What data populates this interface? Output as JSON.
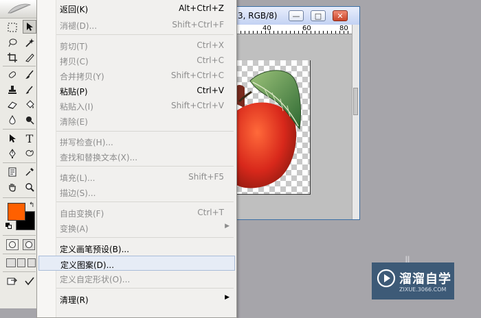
{
  "document": {
    "title": "3, RGB/8)",
    "ruler_labels": [
      "40",
      "60",
      "80"
    ],
    "buttons": {
      "minimize": "—",
      "maximize": "□",
      "close": "✕"
    }
  },
  "menu": {
    "items": [
      {
        "label": "返回(K)",
        "shortcut": "Alt+Ctrl+Z",
        "enabled": true
      },
      {
        "label": "消褪(D)...",
        "shortcut": "Shift+Ctrl+F",
        "enabled": false
      },
      {
        "label": "剪切(T)",
        "shortcut": "Ctrl+X",
        "enabled": false
      },
      {
        "label": "拷贝(C)",
        "shortcut": "Ctrl+C",
        "enabled": false
      },
      {
        "label": "合并拷贝(Y)",
        "shortcut": "Shift+Ctrl+C",
        "enabled": false
      },
      {
        "label": "粘贴(P)",
        "shortcut": "Ctrl+V",
        "enabled": true
      },
      {
        "label": "粘贴入(I)",
        "shortcut": "Shift+Ctrl+V",
        "enabled": false
      },
      {
        "label": "清除(E)",
        "shortcut": "",
        "enabled": false
      },
      {
        "label": "拼写检查(H)...",
        "shortcut": "",
        "enabled": false
      },
      {
        "label": "查找和替换文本(X)...",
        "shortcut": "",
        "enabled": false
      },
      {
        "label": "填充(L)...",
        "shortcut": "Shift+F5",
        "enabled": false
      },
      {
        "label": "描边(S)...",
        "shortcut": "",
        "enabled": false
      },
      {
        "label": "自由变换(F)",
        "shortcut": "Ctrl+T",
        "enabled": false
      },
      {
        "label": "变换(A)",
        "shortcut": "",
        "enabled": false,
        "submenu": true
      },
      {
        "label": "定义画笔预设(B)...",
        "shortcut": "",
        "enabled": true
      },
      {
        "label": "定义图案(D)...",
        "shortcut": "",
        "enabled": true,
        "highlighted": true
      },
      {
        "label": "定义自定形状(O)...",
        "shortcut": "",
        "enabled": false
      },
      {
        "label": "清理(R)",
        "shortcut": "",
        "enabled": true,
        "submenu": true
      }
    ]
  },
  "toolbox": {
    "foreground_color": "#ff6000",
    "background_color": "#000000",
    "tools": [
      "marquee-icon",
      "move-icon",
      "lasso-icon",
      "magic-wand-icon",
      "crop-icon",
      "slice-icon",
      "healing-brush-icon",
      "brush-icon",
      "clone-stamp-icon",
      "history-brush-icon",
      "eraser-icon",
      "paint-bucket-icon",
      "blur-icon",
      "dodge-icon",
      "path-selection-icon",
      "type-icon",
      "pen-icon",
      "custom-shape-icon",
      "notes-icon",
      "eyedropper-icon",
      "hand-icon",
      "zoom-icon"
    ]
  },
  "watermark": {
    "name": "溜溜自学",
    "url": "ZIXUE.3066.COM",
    "ghost_text": "Ⅱ"
  },
  "colors": {
    "menu_highlight": "#e6ecf6",
    "disabled_text": "#8d8d8d",
    "watermark_bg": "#3d5a77"
  }
}
